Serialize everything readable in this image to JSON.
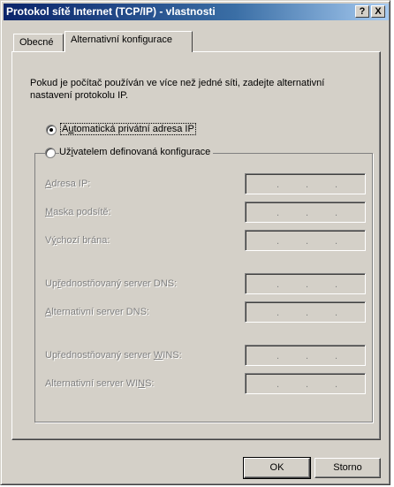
{
  "window": {
    "title": "Protokol sítě Internet (TCP/IP) - vlastnosti",
    "help_btn": "?",
    "close_btn": "X"
  },
  "tabs": [
    {
      "label": "Obecné"
    },
    {
      "label": "Alternativní konfigurace"
    }
  ],
  "intro_text": "Pokud je počítač používán ve více než jedné síti, zadejte alternativní nastavení protokolu IP.",
  "options": {
    "auto": {
      "pre": "A",
      "ul": "u",
      "post": "tomatická privátní adresa IP",
      "selected": true
    },
    "user": {
      "pre": "Už",
      "ul": "i",
      "post": "vatelem definovaná konfigurace",
      "selected": false
    }
  },
  "fields": {
    "ip": {
      "pre": "",
      "ul": "A",
      "post": "dresa IP:"
    },
    "mask": {
      "pre": "",
      "ul": "M",
      "post": "aska podsítě:"
    },
    "gateway": {
      "pre": "V",
      "ul": "ý",
      "post": "chozí brána:"
    },
    "dns_pref": {
      "pre": "Up",
      "ul": "ř",
      "post": "ednostňovaný server DNS:"
    },
    "dns_alt": {
      "pre": "",
      "ul": "A",
      "post": "lternativní server DNS:"
    },
    "wins_pref": {
      "pre": "Upřednostňovaný server ",
      "ul": "W",
      "post": "INS:"
    },
    "wins_alt": {
      "pre": "Alternativní server WI",
      "ul": "N",
      "post": "S:"
    }
  },
  "ip_dot": ".",
  "buttons": {
    "ok": "OK",
    "cancel": "Storno"
  }
}
